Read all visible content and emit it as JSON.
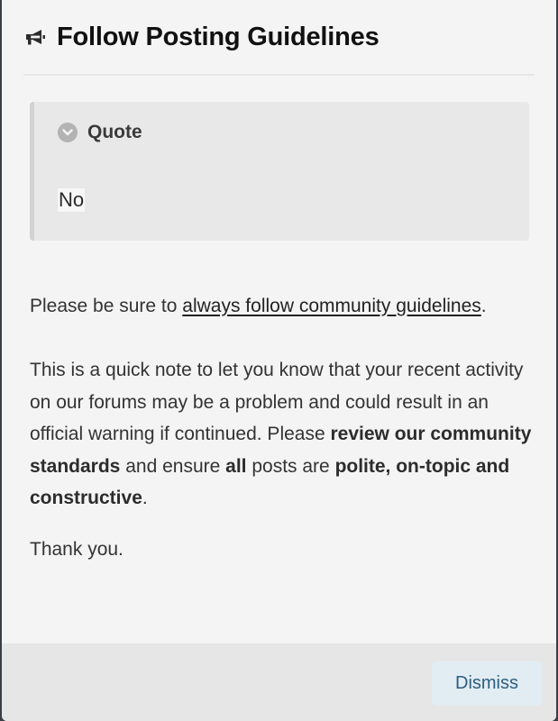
{
  "header": {
    "icon": "megaphone-icon",
    "title": "Follow Posting Guidelines"
  },
  "quote": {
    "icon": "chevron-down-icon",
    "label": "Quote",
    "content": "No"
  },
  "message": {
    "intro_prefix": "Please be sure to ",
    "intro_link": "always follow community guidelines",
    "intro_suffix": ".",
    "note_part1": "This is a quick note to let you know that your recent activity on our forums may be a problem and could result in an official warning if continued. Please ",
    "note_bold1": "review our community standards",
    "note_part2": " and ensure ",
    "note_bold2": "all",
    "note_part3": " posts are ",
    "note_bold3": "polite, on-topic and constructive",
    "note_part4": ".",
    "closing": "Thank you."
  },
  "footer": {
    "dismiss_label": "Dismiss"
  },
  "colors": {
    "modal_bg": "#f4f4f4",
    "footer_bg": "#e6e6e6",
    "quote_bg": "#e8e8e8",
    "dismiss_bg": "#e2ecf3",
    "dismiss_text": "#2b5f7f"
  }
}
